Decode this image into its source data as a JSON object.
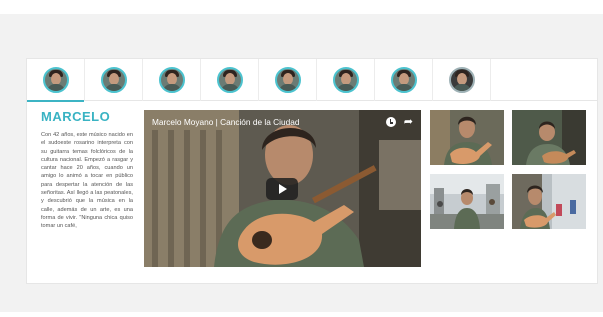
{
  "profile": {
    "name": "MARCELO",
    "bio": "Con 42 años, este músico nacido en el sudoeste rosarino interpreta con su guitarra temas folclóricos de la cultura nacional. Empezó a rasgar y cantar hace 20 años, cuando un amigo lo animó a tocar en público para despertar la atención de las señoritas. Así llegó a las peatonales, y descubrió que la música en la calle, además de un arte, es una forma de vivir. \"Ninguna chica quiso tomar un café,"
  },
  "video": {
    "title": "Marcelo Moyano | Canción de la Ciudad",
    "icons": [
      "clock-icon",
      "share-icon",
      "play-icon"
    ]
  },
  "tabs": [
    {
      "name": "artist-1"
    },
    {
      "name": "artist-2"
    },
    {
      "name": "artist-3"
    },
    {
      "name": "artist-4"
    },
    {
      "name": "artist-5"
    },
    {
      "name": "artist-6"
    },
    {
      "name": "artist-7"
    },
    {
      "name": "artist-8"
    }
  ],
  "active_tab": 0,
  "colors": {
    "accent": "#3cb4c4",
    "avatar_ring": "#4cc3cf",
    "page_bg": "#f2f2f2"
  }
}
